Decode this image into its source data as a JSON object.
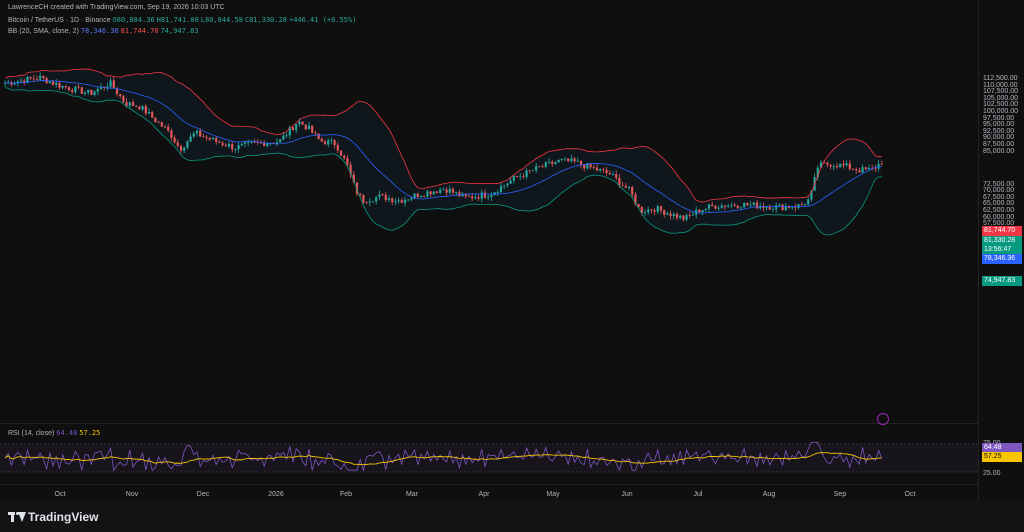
{
  "header": {
    "text": "LawrenceCH created with TradingView.com, Sep 19, 2026 10:03 UTC"
  },
  "legend": {
    "symbol": "Bitcoin / TetherUS · 1D · Binance",
    "o": "O80,884.36",
    "h": "H81,741.00",
    "l": "L80,844.58",
    "c": "C81,330.28",
    "chg": "+446.41 (+0.55%)",
    "bb_label": "BB (20, SMA, close, 2)",
    "bb_basis": "78,346.36",
    "bb_upper": "81,744.70",
    "bb_lower": "74,947.83"
  },
  "rsi": {
    "label": "RSI (14, close)",
    "v1": "64.48",
    "v2": "57.25"
  },
  "price_axis": {
    "ticks": [
      "112,500.00",
      "110,000.00",
      "107,500.00",
      "105,000.00",
      "102,500.00",
      "100,000.00",
      "97,500.00",
      "95,000.00",
      "92,500.00",
      "90,000.00",
      "87,500.00",
      "85,000.00",
      "72,500.00",
      "70,000.00",
      "67,500.00",
      "65,000.00",
      "62,500.00",
      "60,000.00",
      "57,500.00",
      "55,000.00"
    ],
    "rsi_ticks": [
      "75.00",
      "25.00"
    ],
    "badges": {
      "upper": "81,744.70",
      "price": "81,330.28",
      "countdown": "13:56:47",
      "basis": "78,346.36",
      "lower": "74,947.83",
      "rsi1": "64.48",
      "rsi2": "57.25"
    }
  },
  "time_axis": {
    "labels": [
      "Oct",
      "Nov",
      "Dec",
      "2026",
      "Feb",
      "Mar",
      "Apr",
      "May",
      "Jun",
      "Jul",
      "Aug",
      "Sep",
      "Oct"
    ]
  },
  "footer": {
    "brand": "TradingView"
  },
  "colors": {
    "up": "#26a69a",
    "down": "#ef5350",
    "basis": "#2962ff",
    "upper": "#f23645",
    "lower": "#089981",
    "rsi": "#7e57c2",
    "rsi_ma": "#f7c600"
  }
}
